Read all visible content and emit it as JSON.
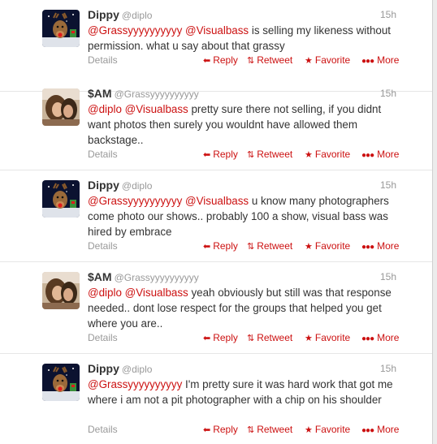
{
  "theme": {
    "link_color": "#cc1111",
    "name_color": "#333333",
    "meta_color": "#999999"
  },
  "actions": {
    "details": "Details",
    "reply": "Reply",
    "retweet": "Retweet",
    "favorite": "Favorite",
    "more": "More",
    "icons": {
      "reply": "reply-arrow-icon",
      "retweet": "retweet-icon",
      "favorite": "star-icon",
      "more": "more-dots-icon"
    }
  },
  "tweets": [
    {
      "name": "Dippy",
      "handle": "@diplo",
      "time": "15h",
      "avatar_icon": "reindeer-avatar",
      "mentions": [
        "@Grassyyyyyyyyyy",
        "@Visualbass"
      ],
      "text": "is selling my likeness without permission. what u say about that grassy"
    },
    {
      "name": "$AM",
      "handle": "@Grassyyyyyyyyyy",
      "time": "15h",
      "avatar_icon": "photo-avatar",
      "mentions": [
        "@diplo",
        "@Visualbass"
      ],
      "text": "pretty sure there not selling, if you didnt want photos then surely you wouldnt have allowed them backstage.."
    },
    {
      "name": "Dippy",
      "handle": "@diplo",
      "time": "15h",
      "avatar_icon": "reindeer-avatar",
      "mentions": [
        "@Grassyyyyyyyyyy",
        "@Visualbass"
      ],
      "text": "u know many photographers come photo our shows.. probably 100 a show, visual bass was hired by embrace"
    },
    {
      "name": "$AM",
      "handle": "@Grassyyyyyyyyyy",
      "time": "15h",
      "avatar_icon": "photo-avatar",
      "mentions": [
        "@diplo",
        "@Visualbass"
      ],
      "text": "yeah obviously but still was that response needed.. dont lose respect for the groups that helped you get where you are.."
    },
    {
      "name": "Dippy",
      "handle": "@diplo",
      "time": "15h",
      "avatar_icon": "reindeer-avatar",
      "mentions": [
        "@Grassyyyyyyyyyy"
      ],
      "text": "I'm pretty sure it was hard work that got me where i am not a pit photographer with a chip on his shoulder"
    }
  ]
}
